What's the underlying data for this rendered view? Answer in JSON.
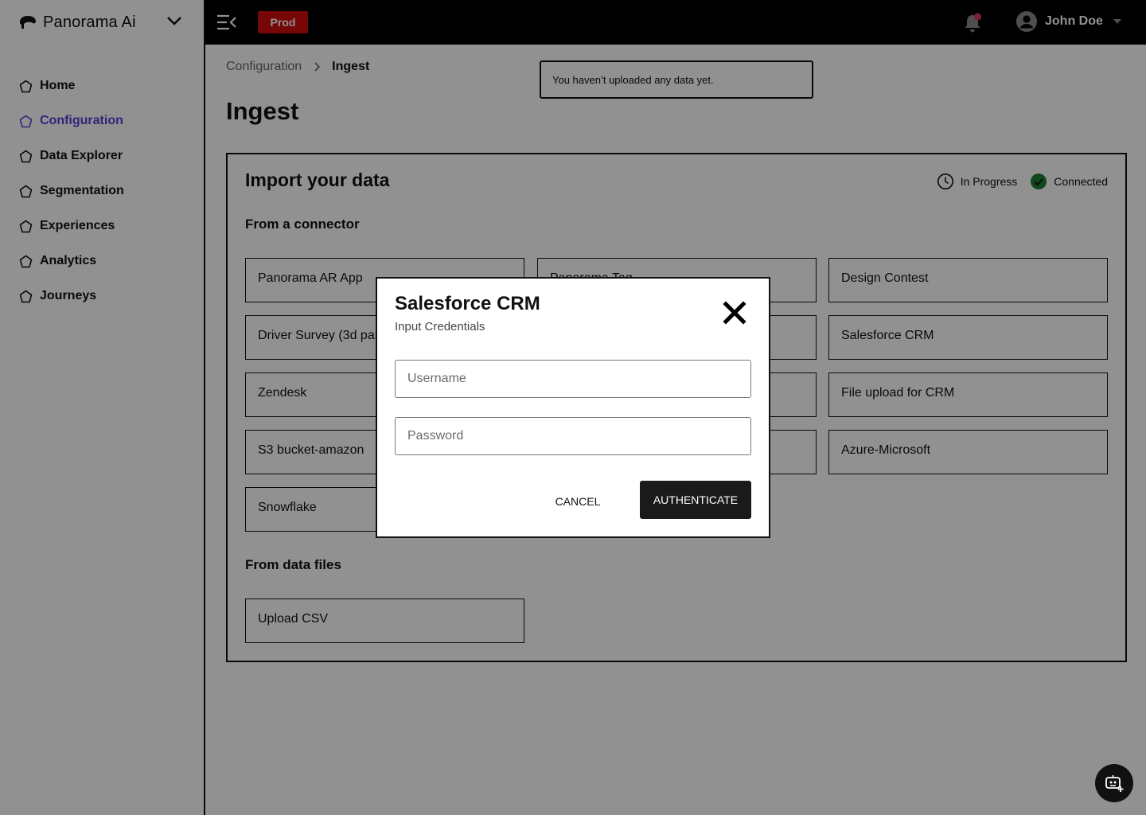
{
  "brand": {
    "name": "Panorama Ai"
  },
  "sidebar": {
    "items": [
      {
        "label": "Home",
        "active": false
      },
      {
        "label": "Configuration",
        "active": true
      },
      {
        "label": "Data Explorer",
        "active": false
      },
      {
        "label": "Segmentation",
        "active": false
      },
      {
        "label": "Experiences",
        "active": false
      },
      {
        "label": "Analytics",
        "active": false
      },
      {
        "label": "Journeys",
        "active": false
      }
    ]
  },
  "topbar": {
    "environment": "Prod",
    "user_name": "John Doe",
    "notification_dot_color": "#d63a5b"
  },
  "breadcrumb": {
    "parent": "Configuration",
    "current": "Ingest"
  },
  "toast": {
    "message": "You haven’t uploaded any data yet."
  },
  "page": {
    "title": "Ingest"
  },
  "panel": {
    "title": "Import your data",
    "legend": {
      "in_progress": "In Progress",
      "connected": "Connected"
    },
    "connector_section": "From a connector",
    "files_section": "From data files",
    "connectors": [
      "Panorama AR App",
      "Panorama Tag",
      "Design Contest",
      "Driver Survey (3d party)",
      "",
      "Salesforce CRM",
      "Zendesk",
      "",
      "File upload for CRM",
      "S3 bucket-amazon",
      "",
      "Azure-Microsoft",
      "Snowflake"
    ],
    "files": [
      "Upload CSV"
    ]
  },
  "modal": {
    "title": "Salesforce CRM",
    "subtitle": "Input Credentials",
    "username_placeholder": "Username",
    "password_placeholder": "Password",
    "cancel_label": "CANCEL",
    "authenticate_label": "AUTHENTICATE"
  },
  "colors": {
    "accent": "#5b3fd6",
    "prod": "#d10b0b",
    "connected": "#1e7d32"
  }
}
